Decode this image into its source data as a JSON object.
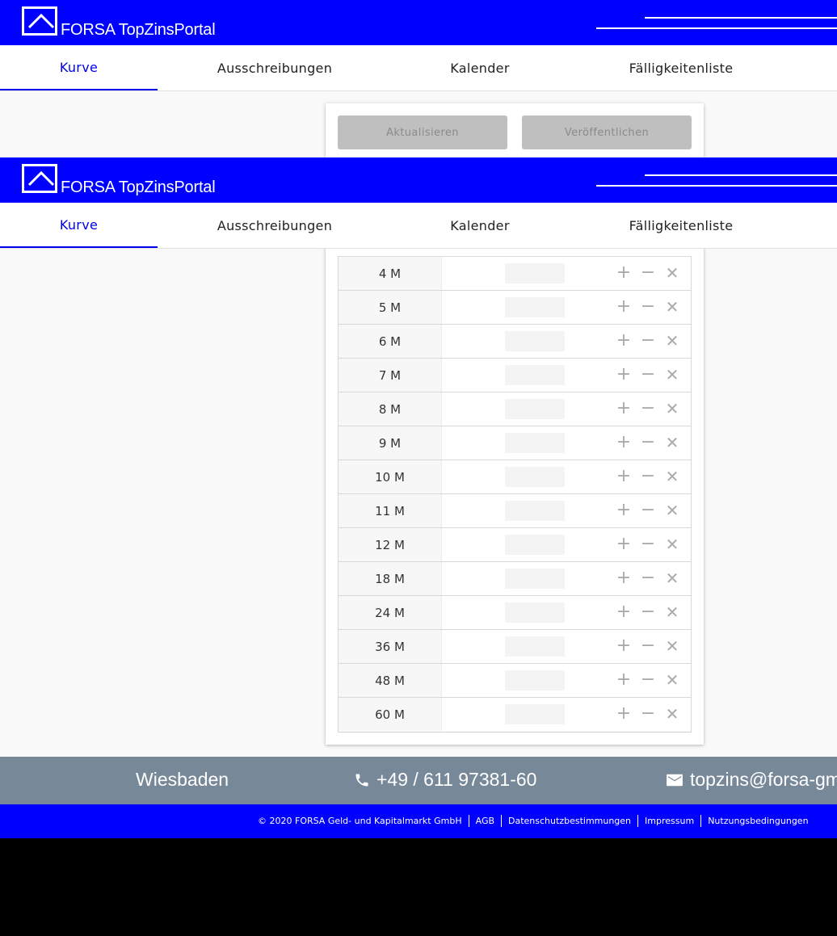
{
  "brand": {
    "name": "FORSA TopZinsPortal"
  },
  "nav": {
    "tabs": [
      "Kurve",
      "Ausschreibungen",
      "Kalender",
      "Fälligkeitenliste"
    ],
    "active": "Kurve"
  },
  "toolbar": {
    "update_label": "Aktualisieren",
    "publish_label": "Veröffentlichen"
  },
  "terms": [
    "4 M",
    "5 M",
    "6 M",
    "7 M",
    "8 M",
    "9 M",
    "10 M",
    "11 M",
    "12 M",
    "18 M",
    "24 M",
    "36 M",
    "48 M",
    "60 M"
  ],
  "row_icons": [
    "plus-icon",
    "minus-icon",
    "close-icon"
  ],
  "footer": {
    "city": "Wiesbaden",
    "phone": "+49 / 611 97381-60",
    "email": "topzins@forsa-gm"
  },
  "legal": {
    "copyright": "© 2020 FORSA Geld- und Kapitalmarkt GmbH",
    "links": [
      "AGB",
      "Datenschutzbestimmungen",
      "Impressum",
      "Nutzungsbedingungen"
    ]
  },
  "colors": {
    "brand_blue": "#0000ff",
    "footer_gray": "#778899",
    "active_tab": "#0000ee",
    "disabled_button": "#bfbfbf"
  }
}
